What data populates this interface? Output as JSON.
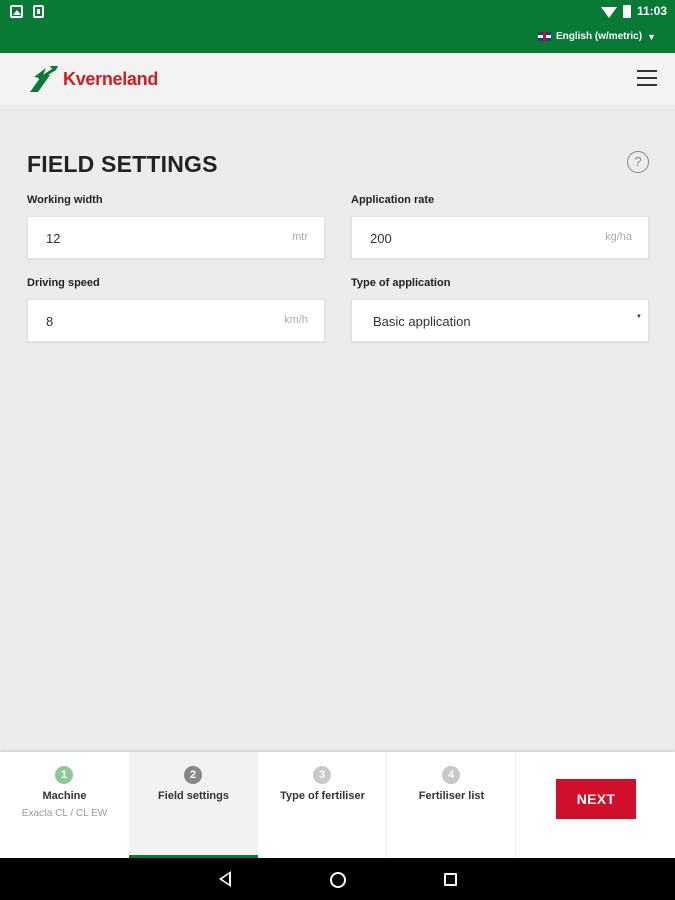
{
  "status_bar": {
    "time": "11:03"
  },
  "language": {
    "label": "English (w/metric)",
    "caret": "▼"
  },
  "header": {
    "brand": "Kverneland"
  },
  "page": {
    "title": "FIELD SETTINGS",
    "help_symbol": "?"
  },
  "fields": {
    "working_width": {
      "label": "Working width",
      "value": "12",
      "unit": "mtr"
    },
    "application_rate": {
      "label": "Application rate",
      "value": "200",
      "unit": "kg/ha"
    },
    "driving_speed": {
      "label": "Driving speed",
      "value": "8",
      "unit": "km/h"
    },
    "type_of_application": {
      "label": "Type of application",
      "value": "Basic application"
    }
  },
  "wizard": {
    "steps": [
      {
        "num": "1",
        "title": "Machine",
        "subtitle": "Exacta CL / CL EW",
        "color": "#8fc79b"
      },
      {
        "num": "2",
        "title": "Field settings",
        "subtitle": "",
        "color": "#888888"
      },
      {
        "num": "3",
        "title": "Type of fertiliser",
        "subtitle": "",
        "color": "#c8c8c8"
      },
      {
        "num": "4",
        "title": "Fertiliser list",
        "subtitle": "",
        "color": "#c8c8c8"
      }
    ],
    "next_label": "NEXT"
  },
  "colors": {
    "brand_green": "#087a35",
    "brand_red": "#d0102a"
  }
}
